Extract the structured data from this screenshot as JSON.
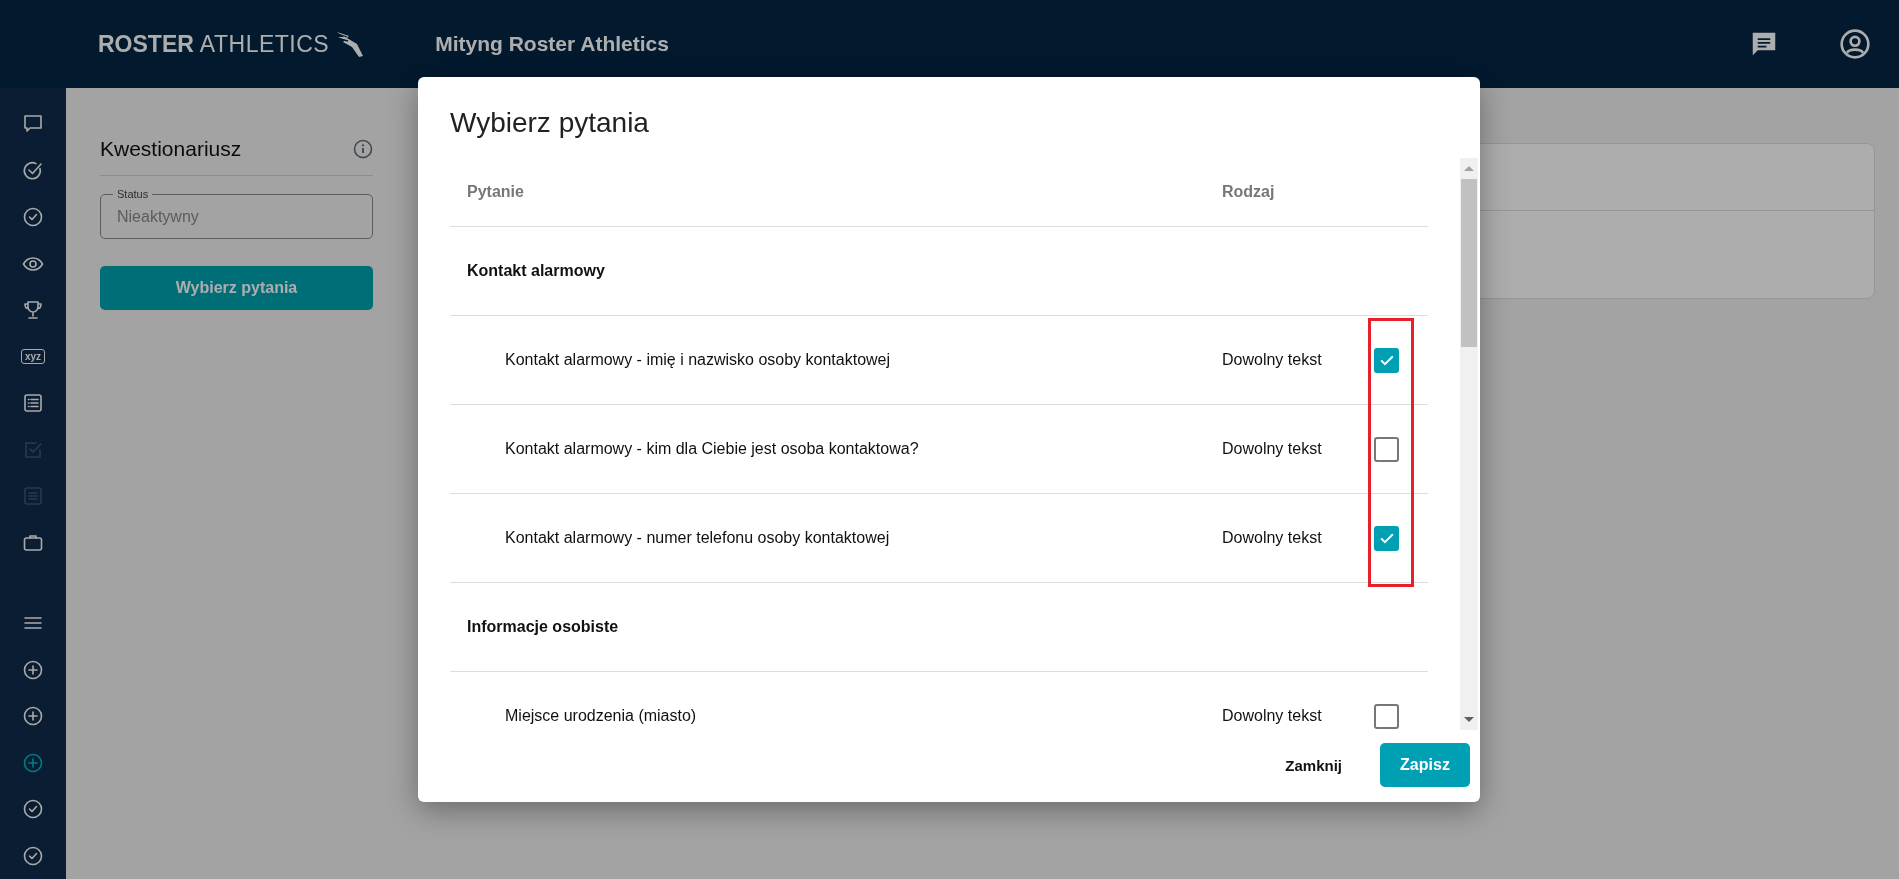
{
  "header": {
    "logo_bold": "ROSTER",
    "logo_light": "ATHLETICS",
    "title": "Mityng Roster Athletics"
  },
  "sidebar": {
    "items": [
      {
        "selected": false,
        "disabled": false
      },
      {
        "selected": false,
        "disabled": false
      },
      {
        "selected": false,
        "disabled": false
      },
      {
        "selected": false,
        "disabled": false
      },
      {
        "selected": false,
        "disabled": false
      },
      {
        "selected": false,
        "disabled": false,
        "label": "xyz"
      },
      {
        "selected": false,
        "disabled": false
      },
      {
        "selected": false,
        "disabled": true
      },
      {
        "selected": false,
        "disabled": true
      },
      {
        "selected": false,
        "disabled": false
      },
      {
        "selected": false,
        "disabled": false
      },
      {
        "selected": false,
        "disabled": false
      },
      {
        "selected": false,
        "disabled": false
      },
      {
        "selected": true,
        "disabled": false
      },
      {
        "selected": false,
        "disabled": false
      },
      {
        "selected": false,
        "disabled": false
      }
    ]
  },
  "panel": {
    "title": "Kwestionariusz",
    "status_field": {
      "label": "Status",
      "value": "Nieaktywny"
    },
    "button": "Wybierz pytania"
  },
  "dialog": {
    "title": "Wybierz pytania",
    "columns": [
      "Pytanie",
      "Rodzaj"
    ],
    "rows": [
      {
        "kind": "group",
        "label": "Kontakt alarmowy"
      },
      {
        "kind": "question",
        "label": "Kontakt alarmowy - imię i nazwisko osoby kontaktowej",
        "type": "Dowolny tekst",
        "checked": true,
        "highlighted": true
      },
      {
        "kind": "question",
        "label": "Kontakt alarmowy - kim dla Ciebie jest osoba kontaktowa?",
        "type": "Dowolny tekst",
        "checked": false,
        "highlighted": true
      },
      {
        "kind": "question",
        "label": "Kontakt alarmowy - numer telefonu osoby kontaktowej",
        "type": "Dowolny tekst",
        "checked": true,
        "highlighted": true
      },
      {
        "kind": "group",
        "label": "Informacje osobiste"
      },
      {
        "kind": "question",
        "label": "Miejsce urodzenia (miasto)",
        "type": "Dowolny tekst",
        "checked": false,
        "highlighted": false
      }
    ],
    "buttons": [
      {
        "kind": "text",
        "label": "Zamknij"
      },
      {
        "kind": "primary",
        "label": "Zapisz"
      }
    ]
  }
}
